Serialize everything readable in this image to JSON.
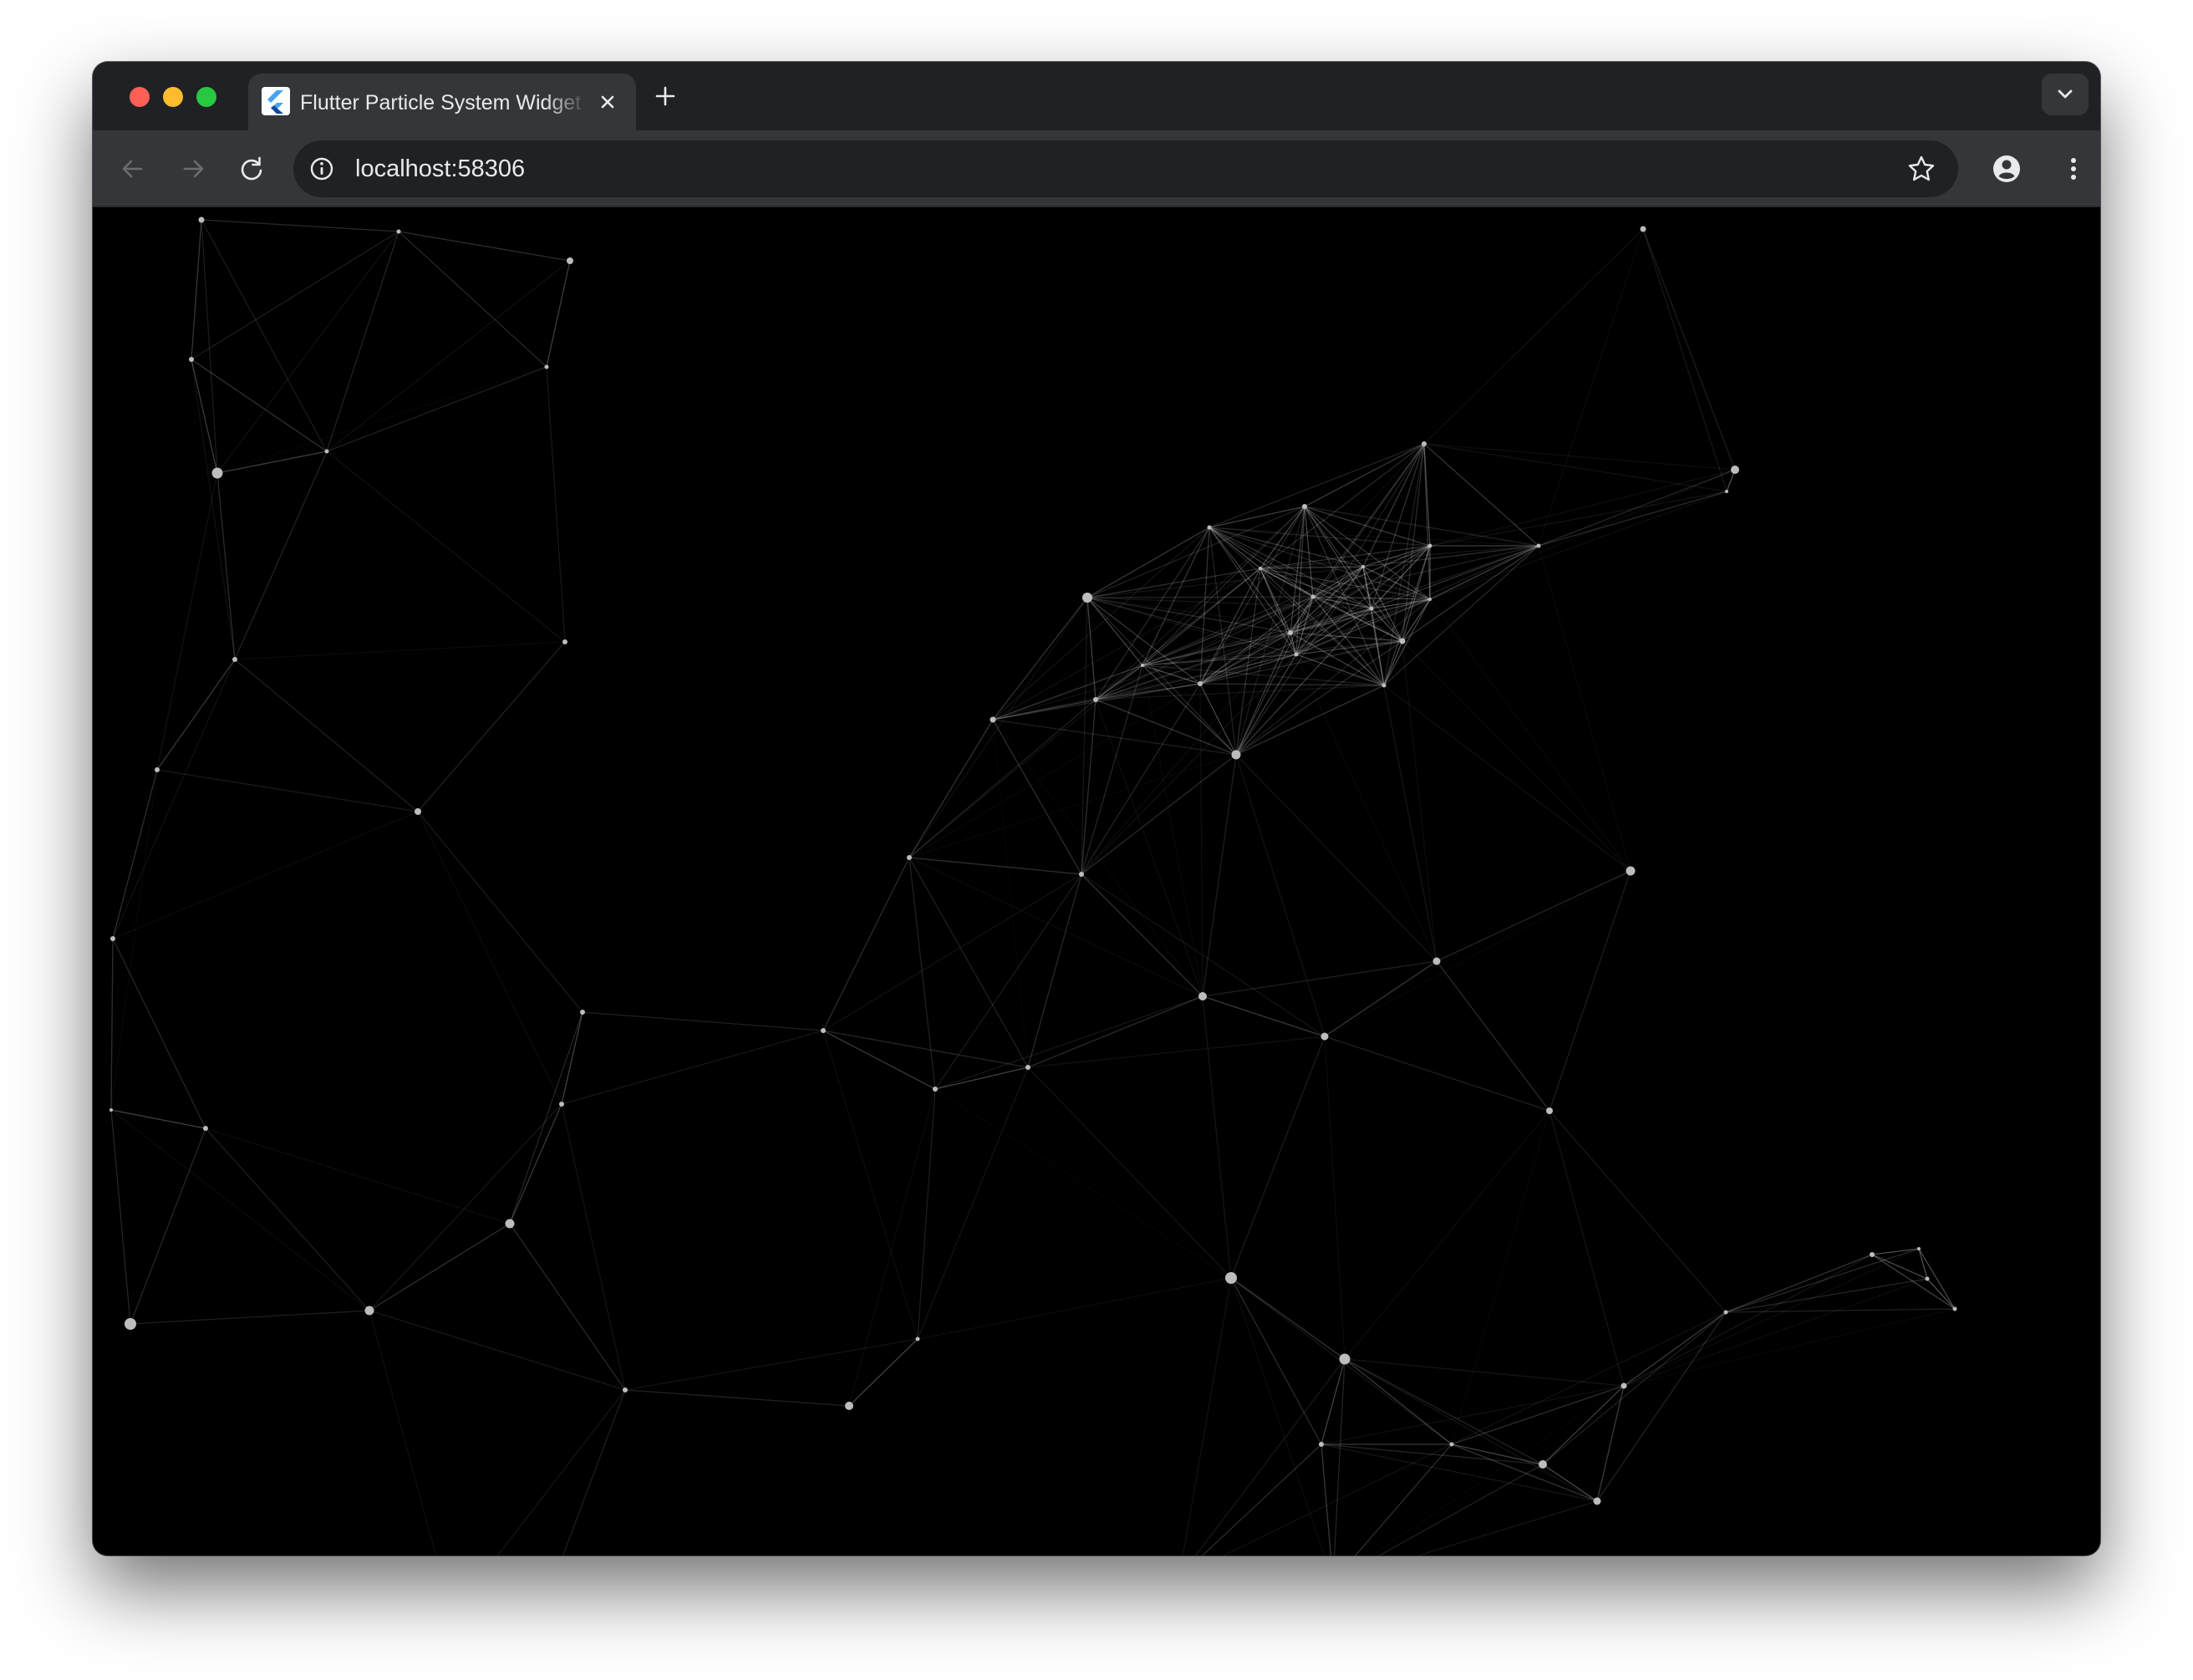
{
  "browser": {
    "tab": {
      "title": "Flutter Particle System Widget",
      "favicon": "flutter-logo-icon"
    },
    "new_tab_icon": "plus-icon",
    "tab_list_icon": "chevron-down-icon",
    "nav": {
      "back_icon": "arrow-left-icon",
      "forward_icon": "arrow-right-icon",
      "reload_icon": "reload-icon"
    },
    "address_bar": {
      "url": "localhost:58306",
      "site_info_icon": "info-icon",
      "bookmark_icon": "star-icon"
    },
    "profile_icon": "avatar-icon",
    "menu_icon": "kebab-menu-icon"
  },
  "colors": {
    "window_chrome": "#202124",
    "toolbar": "#35363a",
    "canvas_background": "#000000",
    "particle": "#bdbdbd",
    "link": "#ffffff"
  },
  "particle_system": {
    "particle_count": 71,
    "particles": [
      [
        130,
        15,
        3.5
      ],
      [
        366,
        29,
        2.5
      ],
      [
        571,
        64,
        4
      ],
      [
        1855,
        26,
        3.5
      ],
      [
        118,
        182,
        3
      ],
      [
        543,
        191,
        2.5
      ],
      [
        149,
        318,
        6.5
      ],
      [
        1593,
        283,
        3
      ],
      [
        1965,
        314,
        5
      ],
      [
        1955,
        340,
        2
      ],
      [
        1450,
        358,
        3
      ],
      [
        1336,
        383,
        2.5
      ],
      [
        1397,
        432,
        2
      ],
      [
        1190,
        467,
        6
      ],
      [
        1567,
        519,
        3.5
      ],
      [
        565,
        520,
        3
      ],
      [
        1077,
        613,
        3.5
      ],
      [
        170,
        541,
        3
      ],
      [
        1200,
        589,
        3
      ],
      [
        1368,
        655,
        5.5
      ],
      [
        1545,
        572,
        2.5
      ],
      [
        1433,
        509,
        3
      ],
      [
        77,
        673,
        3
      ],
      [
        389,
        723,
        4
      ],
      [
        977,
        778,
        3
      ],
      [
        1183,
        798,
        3
      ],
      [
        1840,
        794,
        5.5
      ],
      [
        1608,
        902,
        4.5
      ],
      [
        1474,
        992,
        4.5
      ],
      [
        1328,
        944,
        5
      ],
      [
        1008,
        1055,
        3
      ],
      [
        24,
        875,
        3
      ],
      [
        586,
        963,
        3
      ],
      [
        874,
        985,
        3
      ],
      [
        1119,
        1029,
        3
      ],
      [
        135,
        1102,
        3
      ],
      [
        22,
        1080,
        2
      ],
      [
        561,
        1073,
        3
      ],
      [
        1743,
        1081,
        4
      ],
      [
        499,
        1216,
        5.5
      ],
      [
        331,
        1320,
        5.5
      ],
      [
        45,
        1336,
        7
      ],
      [
        1362,
        1281,
        7
      ],
      [
        1954,
        1322,
        2.5
      ],
      [
        2129,
        1253,
        3
      ],
      [
        2185,
        1246,
        2
      ],
      [
        1832,
        1410,
        3.5
      ],
      [
        637,
        1415,
        3
      ],
      [
        905,
        1434,
        5
      ],
      [
        987,
        1354,
        2.5
      ],
      [
        1498,
        1378,
        6.5
      ],
      [
        1470,
        1480,
        3
      ],
      [
        1626,
        1480,
        2.5
      ],
      [
        1735,
        1504,
        5
      ],
      [
        1800,
        1548,
        4.5
      ],
      [
        1300,
        1639,
        6.5
      ],
      [
        1484,
        1644,
        6
      ],
      [
        430,
        1684,
        5
      ],
      [
        533,
        1692,
        4
      ],
      [
        2228,
        1318,
        2.5
      ],
      [
        2195,
        1282,
        2.5
      ],
      [
        280,
        292,
        2.5
      ],
      [
        1256,
        548,
        2
      ],
      [
        1325,
        570,
        3
      ],
      [
        1460,
        466,
        2.5
      ],
      [
        1600,
        469,
        2
      ],
      [
        1600,
        405,
        2.5
      ],
      [
        1730,
        405,
        2.5
      ],
      [
        1440,
        535,
        2.5
      ],
      [
        1530,
        480,
        2.5
      ],
      [
        1520,
        430,
        2
      ]
    ],
    "link_distance": 420
  }
}
